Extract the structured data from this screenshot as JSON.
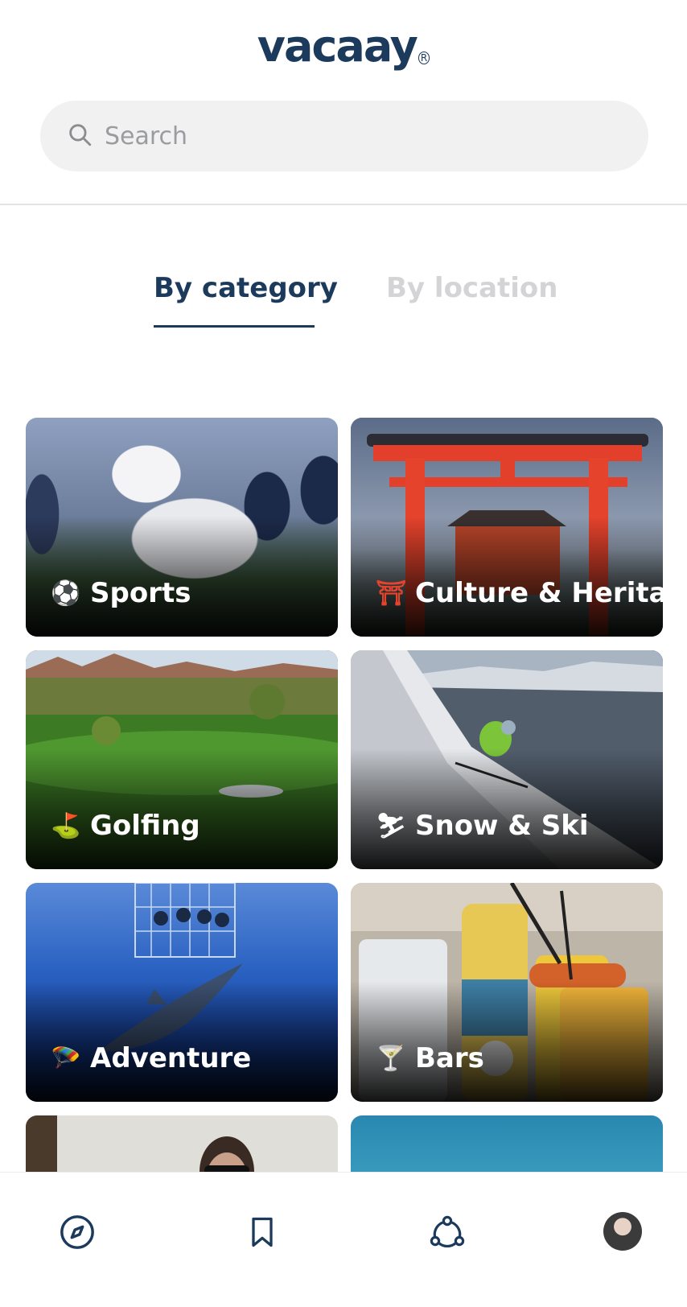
{
  "app": {
    "logo": "vacaay",
    "logo_mark": "R"
  },
  "search": {
    "placeholder": "Search",
    "icon": "search-icon"
  },
  "tabs": [
    {
      "label": "By category",
      "active": true
    },
    {
      "label": "By location",
      "active": false
    }
  ],
  "categories": [
    {
      "emoji": "⚽",
      "label": "Sports"
    },
    {
      "emoji": "⛩",
      "label": "Culture & Heritage"
    },
    {
      "emoji": "⛳",
      "label": "Golfing"
    },
    {
      "emoji": "⛷",
      "label": "Snow & Ski"
    },
    {
      "emoji": "🪂",
      "label": "Adventure"
    },
    {
      "emoji": "🍸",
      "label": "Bars"
    }
  ],
  "nav": {
    "items": [
      "compass-icon",
      "bookmark-icon",
      "community-icon",
      "profile-avatar"
    ]
  },
  "colors": {
    "brand": "#1b3a5c",
    "tab_inactive": "#d4d4d6",
    "search_bg": "#f1f1f2"
  }
}
